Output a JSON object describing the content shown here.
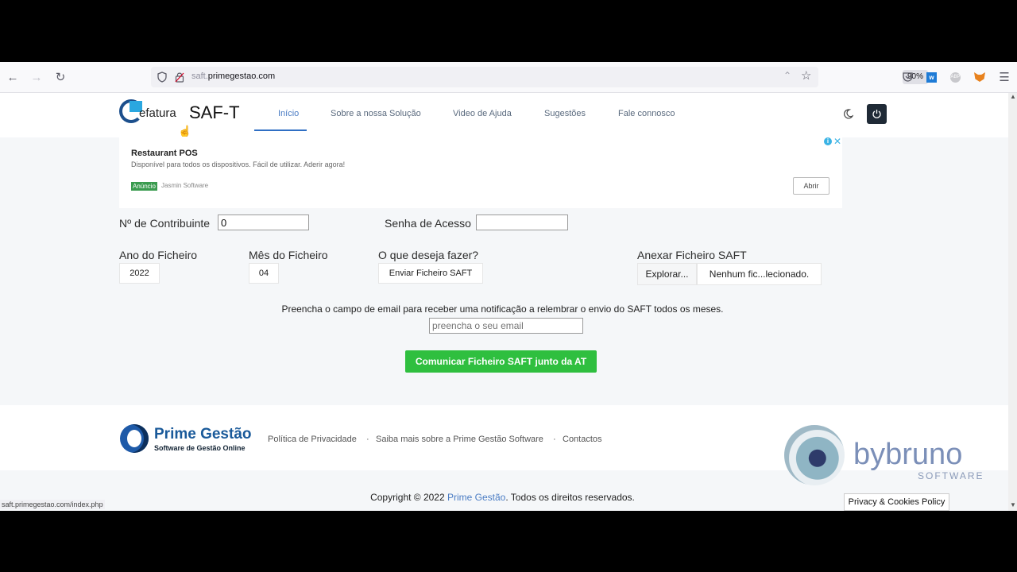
{
  "browser": {
    "url_host_prefix": "saft.",
    "url_host": "primegestao.com",
    "zoom": "90%",
    "status_url": "saft.primegestao.com/index.php",
    "icons": [
      "back-icon",
      "forward-icon",
      "reload-icon",
      "shield-icon",
      "lock-icon",
      "reader-icon",
      "star-icon",
      "pocket-icon",
      "extension-icon",
      "adblock-icon",
      "metamask-icon",
      "menu-icon"
    ]
  },
  "header": {
    "logo_text": "efatura",
    "product": "SAF-T",
    "nav": [
      {
        "label": "Início"
      },
      {
        "label": "Sobre a nossa Solução"
      },
      {
        "label": "Video de Ajuda"
      },
      {
        "label": "Sugestões"
      },
      {
        "label": "Fale connosco"
      }
    ]
  },
  "ad": {
    "title": "Restaurant POS",
    "description": "Disponível para todos os dispositivos. Fácil de utilizar. Aderir agora!",
    "badge": "Anúncio",
    "advertiser": "Jasmin Software",
    "cta": "Abrir"
  },
  "form": {
    "nif_label": "Nº de Contribuinte",
    "nif_value": "0",
    "password_label": "Senha de Acesso",
    "year_label": "Ano do Ficheiro",
    "year_value": "2022",
    "month_label": "Mês do Ficheiro",
    "month_value": "04",
    "action_label": "O que deseja fazer?",
    "action_value": "Enviar Ficheiro SAFT",
    "attach_label": "Anexar Ficheiro SAFT",
    "browse_label": "Explorar...",
    "file_status": "Nenhum fic...lecionado.",
    "email_prompt": "Preencha o campo de email para receber uma notificação a relembrar o envio do SAFT todos os meses.",
    "email_placeholder": "preencha o seu email",
    "submit_label": "Comunicar Ficheiro SAFT junto da AT"
  },
  "footer": {
    "brand_name": "Prime Gestão",
    "brand_tagline": "Software de Gestão Online",
    "links": [
      "Política de Privacidade",
      "Saiba mais sobre a Prime Gestão Software",
      "Contactos"
    ],
    "copyright_prefix": "Copyright © 2022 ",
    "copyright_brand": "Prime Gestão",
    "copyright_suffix": ". Todos os direitos reservados.",
    "watermark_name": "bybruno",
    "watermark_sub": "SOFTWARE",
    "cookies": "Privacy & Cookies Policy"
  },
  "colors": {
    "accent": "#2fbf3f",
    "brand_blue": "#1a5a9a",
    "watermark": "#7b8fb8"
  }
}
